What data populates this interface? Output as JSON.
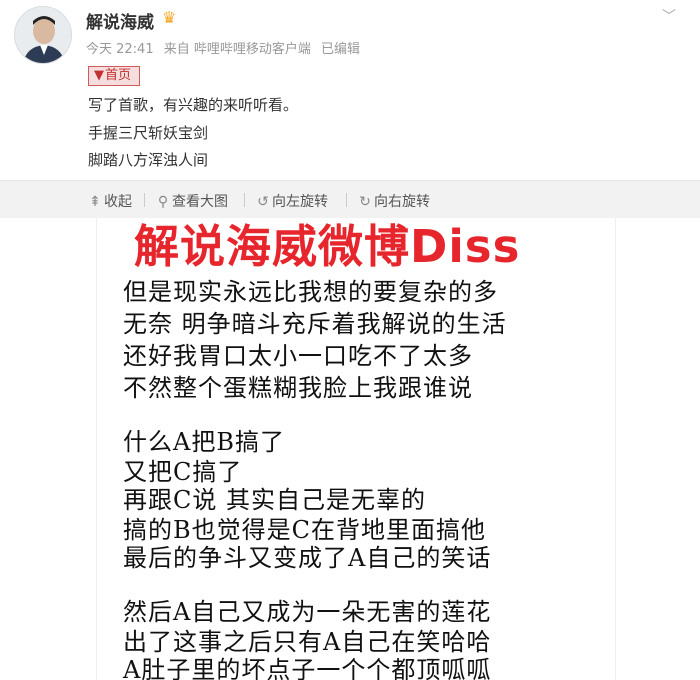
{
  "post": {
    "username": "解说海威",
    "badge_icon": "vip-crown-icon",
    "time": "今天 22:41",
    "source": "来自 哔哩哔哩移动客户端",
    "edited": "已编辑",
    "tag_label": "首页",
    "lines": [
      "写了首歌，有兴趣的来听听看。",
      "手握三尺斩妖宝剑",
      "脚踏八方浑浊人间"
    ]
  },
  "toolbar": {
    "collapse": "收起",
    "view_large": "查看大图",
    "rotate_left": "向左旋转",
    "rotate_right": "向右旋转"
  },
  "image": {
    "overlay_title": "解说海威微博Diss",
    "lyrics": [
      "但是现实永远比我想的要复杂的多",
      "无奈 明争暗斗充斥着我解说的生活",
      "还好我胃口太小一口吃不了太多",
      "不然整个蛋糕糊我脸上我跟谁说",
      "什么A把B搞了",
      "又把C搞了",
      "再跟C说 其实自己是无辜的",
      "搞的B也觉得是C在背地里面搞他",
      "最后的争斗又变成了A自己的笑话",
      "然后A自己又成为一朵无害的莲花",
      "出了这事之后只有A自己在笑哈哈",
      "A肚子里的坏点子一个个都顶呱呱"
    ]
  },
  "colors": {
    "overlay_red": "#e6262c",
    "tag_red": "#c23030"
  }
}
